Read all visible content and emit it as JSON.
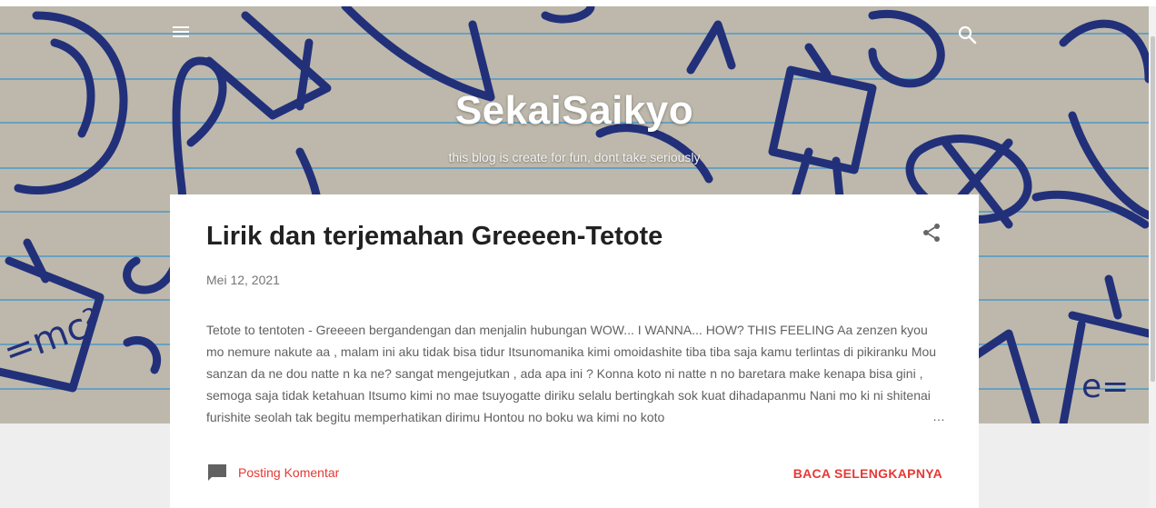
{
  "header": {
    "title": "SekaiSaikyo",
    "description": "this blog is create for fun, dont take seriously",
    "menu_icon": "hamburger-menu-icon",
    "search_icon": "search-icon"
  },
  "post": {
    "title": "Lirik dan terjemahan Greeeen-Tetote",
    "date": "Mei 12, 2021",
    "snippet": " Tetote to tentoten - Greeeen bergandengan dan menjalin hubungan   WOW... I WANNA... HOW? THIS FEELING   Aa zenzen kyou mo nemure nakute aa , malam ini aku tidak bisa tidur Itsunomanika kimi omoidashite tiba tiba saja kamu terlintas di pikiranku Mou sanzan da ne dou natte n ka ne? sangat mengejutkan , ada apa ini ? Konna koto ni natte n no baretara make kenapa bisa gini , semoga saja tidak ketahuan   Itsumo kimi no mae tsuyogatte diriku selalu bertingkah sok kuat dihadapanmu Nani mo ki ni shitenai furishite seolah tak begitu memperhatikan dirimu Hontou no boku wa kimi no koto",
    "ellipsis": "…",
    "share_icon": "share-icon",
    "comment_icon": "comment-icon",
    "comment_label": "Posting Komentar",
    "read_more_label": "BACA SELENGKAPNYA"
  },
  "colors": {
    "accent": "#e53935",
    "hero_background": "#bdb8ab",
    "doodle_ink": "#22307a",
    "notebook_lines": "#5f9ec4",
    "page_background": "#eeeeee"
  }
}
